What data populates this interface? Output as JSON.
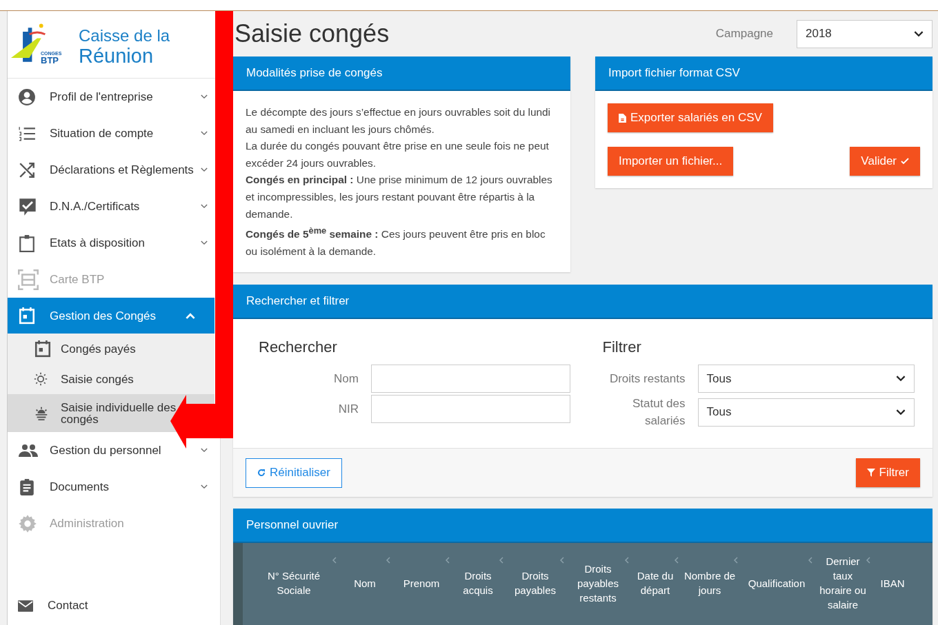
{
  "sidebar": {
    "logo": {
      "small_text": "CONGES",
      "brand": "BTP",
      "title_line_1": "Caisse de la",
      "title_line_2": "Réunion"
    },
    "items": [
      {
        "label": "Profil de l'entreprise",
        "disabled": false,
        "selected": false,
        "expanded": false
      },
      {
        "label": "Situation de compte",
        "disabled": false,
        "selected": false,
        "expanded": false
      },
      {
        "label": "Déclarations et Règlements",
        "disabled": false,
        "selected": false,
        "expanded": false
      },
      {
        "label": "D.N.A./Certificats",
        "disabled": false,
        "selected": false,
        "expanded": false
      },
      {
        "label": "Etats à disposition",
        "disabled": false,
        "selected": false,
        "expanded": false
      },
      {
        "label": "Carte BTP",
        "disabled": true,
        "selected": false
      },
      {
        "label": "Gestion des Congés",
        "disabled": false,
        "selected": true,
        "expanded": true,
        "children": [
          {
            "label": "Congés payés",
            "selected": false
          },
          {
            "label": "Saisie congés",
            "selected": false
          },
          {
            "label": "Saisie individuelle des congés",
            "selected": true
          }
        ]
      },
      {
        "label": "Gestion du personnel",
        "disabled": false,
        "selected": false,
        "expanded": false
      },
      {
        "label": "Documents",
        "disabled": false,
        "selected": false,
        "expanded": false
      },
      {
        "label": "Administration",
        "disabled": true,
        "selected": false
      }
    ],
    "contact": "Contact"
  },
  "page_title": "Saisie congés",
  "campaign": {
    "label": "Campagne",
    "value": "2018"
  },
  "rules_card": {
    "title": "Modalités prise de congés",
    "paragraphs": [
      "Le décompte des jours s’effectue en jours ouvrables soit du lundi au samedi en incluant les jours chômés.",
      "La durée du congés pouvant être prise en une seule fois ne peut excéder 24 jours ouvrables.",
      "**Congés en principal :** Une prise minimum de 12 jours ouvrables et incompressibles, les jours restant pouvant être répartis à la demande.",
      "**Congés de 5$^{ème}$ semaine :** Ces jours peuvent être pris en bloc ou isolément à la demande."
    ]
  },
  "import_card": {
    "title": "Import fichier format CSV",
    "export_button": "Exporter salariés en CSV",
    "import_button": "Importer un fichier...",
    "validate_button": "Valider"
  },
  "filter_card": {
    "title": "Rechercher et filtrer",
    "search_heading": "Rechercher",
    "filter_heading": "Filtrer",
    "search_fields": [
      {
        "label": "Nom"
      },
      {
        "label": "NIR"
      }
    ],
    "filter_fields": [
      {
        "label": "Droits restants",
        "value": "Tous"
      },
      {
        "label": "Statut des salariés",
        "value": "Tous"
      }
    ],
    "reset_button": "Réinitialiser",
    "filter_button": "Filtrer"
  },
  "workers_card": {
    "title": "Personnel ouvrier",
    "columns": [
      "N° Sécurité Sociale",
      "Nom",
      "Prenom",
      "Droits acquis",
      "Droits payables",
      "Droits payables restants",
      "Date du départ",
      "Nombre de jours",
      "Qualification",
      "Dernier taux horaire ou salaire",
      "IBAN"
    ]
  }
}
